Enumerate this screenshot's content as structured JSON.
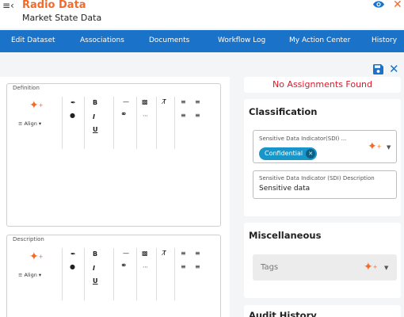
{
  "header": {
    "title": "Radio Data",
    "subtitle": "Market State Data"
  },
  "nav": {
    "items": [
      "Edit Dataset",
      "Associations",
      "Documents",
      "Workflow Log",
      "My Action Center",
      "History"
    ]
  },
  "editors": {
    "definition_label": "Definition",
    "description_label": "Description",
    "align_label": "Align",
    "bold": "B",
    "italic": "I",
    "underline": "U"
  },
  "assignments": {
    "message": "No Assignments Found"
  },
  "classification": {
    "title": "Classification",
    "sdi_label": "Sensitive Data Indicator(SDI) ...",
    "sdi_value": "Confidential",
    "sdi_desc_label": "Sensitive Data Indicator (SDI) Description",
    "sdi_desc_value": "Sensitive data"
  },
  "misc": {
    "title": "Miscellaneous",
    "tags_placeholder": "Tags"
  },
  "audit": {
    "title": "Audit History"
  },
  "colors": {
    "accent_orange": "#f26b2a",
    "nav_blue": "#1a73c9",
    "chip_blue": "#1895c9",
    "error_red": "#e0192a"
  }
}
